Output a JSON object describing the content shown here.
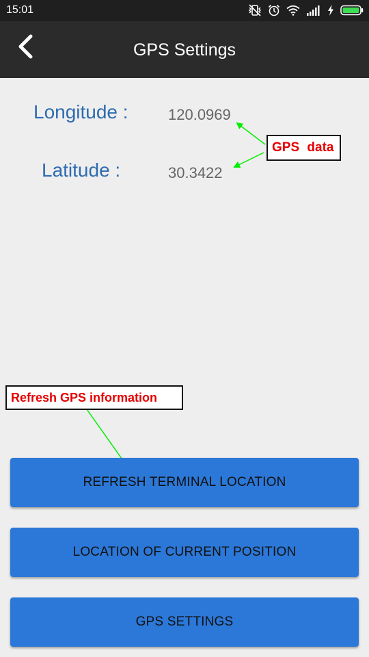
{
  "status_bar": {
    "time": "15:01",
    "icons": [
      "vibrate-off-icon",
      "alarm-icon",
      "wifi-icon",
      "signal-icon",
      "charging-bolt-icon",
      "battery-icon"
    ],
    "background": "#1f1f1f"
  },
  "app_bar": {
    "title": "GPS Settings",
    "back_icon": "chevron-left-icon",
    "background": "#2b2b2b"
  },
  "gps": {
    "longitude_label": "Longitude :",
    "longitude_value": "120.0969",
    "latitude_label": "Latitude :",
    "latitude_value": "30.3422"
  },
  "annotations": {
    "gps_data": "GPS data",
    "refresh_info": "Refresh GPS information",
    "text_color": "#e60000",
    "arrow_color": "#00ee00"
  },
  "buttons": {
    "refresh_terminal": "REFRESH TERMINAL LOCATION",
    "current_position": "LOCATION OF CURRENT POSITION",
    "gps_settings": "GPS SETTINGS",
    "color": "#2b78d8"
  }
}
